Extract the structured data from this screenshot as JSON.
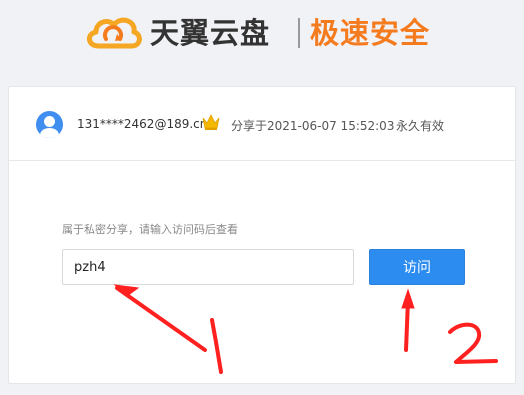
{
  "header": {
    "brand_name": "天翼云盘",
    "slogan": "极速安全",
    "logo_icon": "cloud-logo-icon",
    "brand_color": "#f57b1f"
  },
  "share": {
    "user": "131****2462@189.cn",
    "vip_icon": "crown-icon",
    "shared_at": "分享于2021-06-07 15:52:03",
    "validity": "永久有效"
  },
  "access": {
    "hint": "属于私密分享，请输入访问码后查看",
    "code_value": "pzh4",
    "visit_label": "访问",
    "button_color": "#2d8cf0"
  },
  "annotations": {
    "color": "#ff2020",
    "marks": [
      "1",
      "2"
    ]
  }
}
